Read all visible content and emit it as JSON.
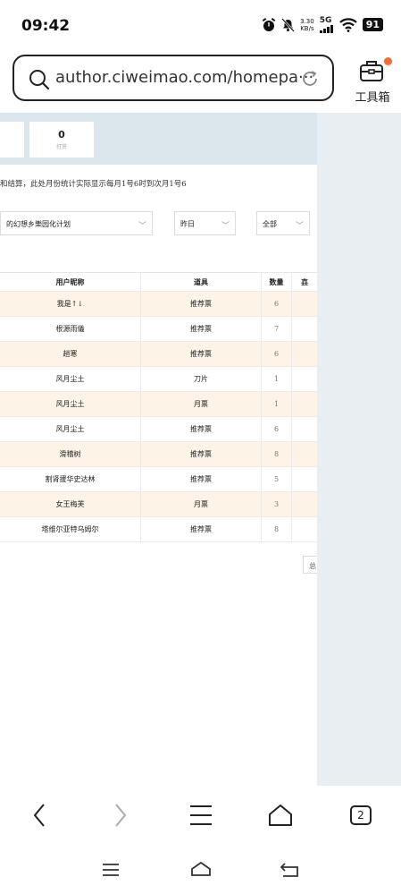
{
  "status": {
    "time": "09:42",
    "speed_top": "3.30",
    "speed_bottom": "KB/s",
    "network": "5G",
    "battery": "91"
  },
  "browser": {
    "url": "author.ciweimao.com/homepa···",
    "toolbox_label": "工具箱",
    "tab_count": "2"
  },
  "stats": {
    "count": "0",
    "label": "打赏"
  },
  "notice": "和结算，此处月份统计实际显示每月1号6时到次月1号6",
  "filters": {
    "book": "的幻想乡樂园化计划",
    "date": "昨日",
    "type": "全部"
  },
  "table": {
    "headers": [
      "用户昵称",
      "道具",
      "数量",
      "壵"
    ],
    "rows": [
      {
        "nickname": "我是↑↓",
        "item": "推荐票",
        "qty": "6"
      },
      {
        "nickname": "根源雨儀",
        "item": "推荐票",
        "qty": "7"
      },
      {
        "nickname": "趟寒",
        "item": "推荐票",
        "qty": "6"
      },
      {
        "nickname": "风月尘土",
        "item": "刀片",
        "qty": "1"
      },
      {
        "nickname": "风月尘土",
        "item": "月票",
        "qty": "1"
      },
      {
        "nickname": "风月尘土",
        "item": "推荐票",
        "qty": "6"
      },
      {
        "nickname": "滑稽树",
        "item": "推荐票",
        "qty": "8"
      },
      {
        "nickname": "割肾援华史达林",
        "item": "推荐票",
        "qty": "5"
      },
      {
        "nickname": "女王梅芙",
        "item": "月票",
        "qty": "3"
      },
      {
        "nickname": "塔维尔亚特乌姆尔",
        "item": "推荐票",
        "qty": "8"
      }
    ]
  },
  "pager": {
    "total_label": "总"
  }
}
